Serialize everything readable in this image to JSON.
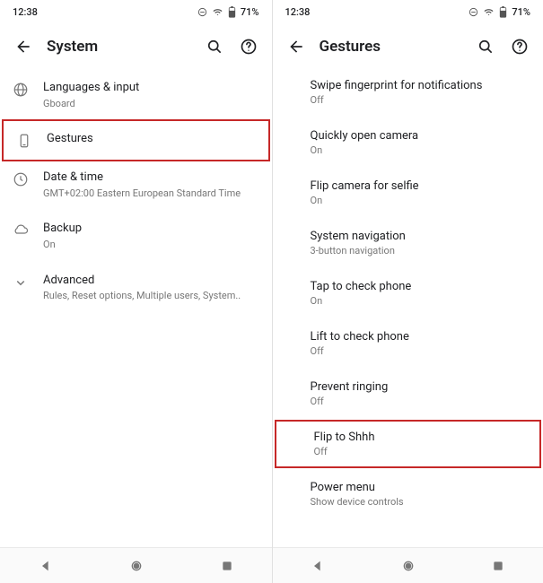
{
  "left": {
    "status": {
      "time": "12:38",
      "battery": "71%"
    },
    "appbar": {
      "title": "System"
    },
    "items": [
      {
        "label": "Languages & input",
        "sub": "Gboard"
      },
      {
        "label": "Gestures",
        "sub": ""
      },
      {
        "label": "Date & time",
        "sub": "GMT+02:00 Eastern European Standard Time"
      },
      {
        "label": "Backup",
        "sub": "On"
      },
      {
        "label": "Advanced",
        "sub": "Rules, Reset options, Multiple users, System.."
      }
    ]
  },
  "right": {
    "status": {
      "time": "12:38",
      "battery": "71%"
    },
    "appbar": {
      "title": "Gestures"
    },
    "items": [
      {
        "label": "Swipe fingerprint for notifications",
        "sub": "Off"
      },
      {
        "label": "Quickly open camera",
        "sub": "On"
      },
      {
        "label": "Flip camera for selfie",
        "sub": "On"
      },
      {
        "label": "System navigation",
        "sub": "3-button navigation"
      },
      {
        "label": "Tap to check phone",
        "sub": "On"
      },
      {
        "label": "Lift to check phone",
        "sub": "Off"
      },
      {
        "label": "Prevent ringing",
        "sub": "Off"
      },
      {
        "label": "Flip to Shhh",
        "sub": "Off"
      },
      {
        "label": "Power menu",
        "sub": "Show device controls"
      }
    ]
  }
}
